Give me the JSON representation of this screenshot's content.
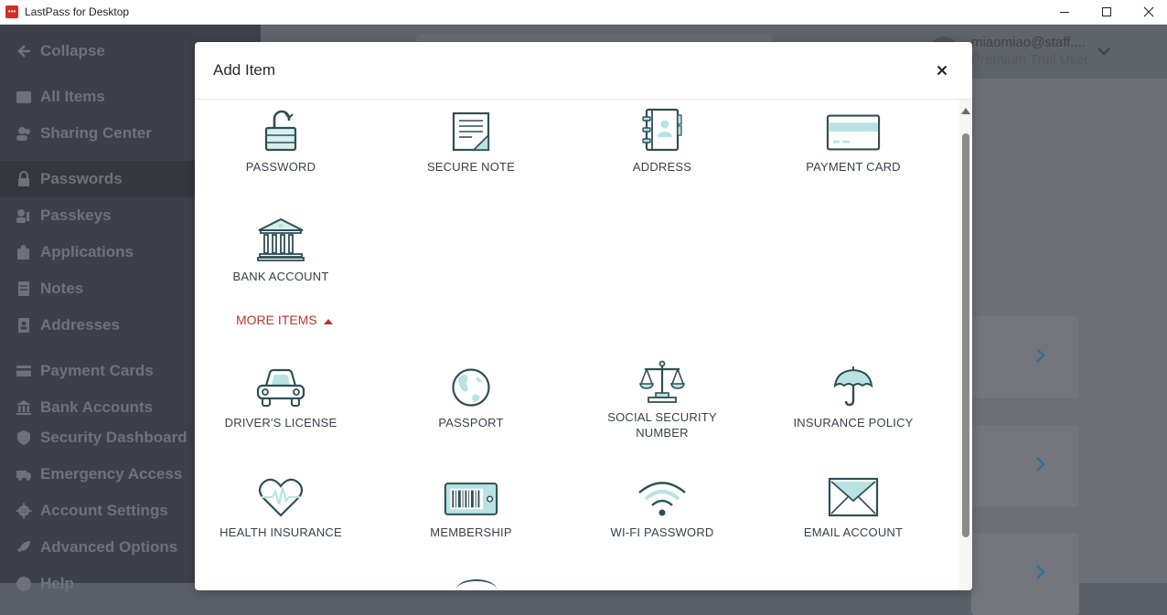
{
  "window": {
    "title": "LastPass for Desktop",
    "app_icon_glyph": "•••",
    "controls": [
      "minimize-icon",
      "maximize-icon",
      "close-icon"
    ]
  },
  "sidebar": {
    "collapse_label": "Collapse",
    "items": [
      {
        "label": "All Items",
        "icon": "home-icon"
      },
      {
        "label": "Sharing Center",
        "icon": "users-icon"
      },
      {
        "label": "Passwords",
        "icon": "lock-icon",
        "active": true
      },
      {
        "label": "Passkeys",
        "icon": "passkey-icon"
      },
      {
        "label": "Applications",
        "icon": "puzzle-icon"
      },
      {
        "label": "Notes",
        "icon": "note-icon"
      },
      {
        "label": "Addresses",
        "icon": "address-book-icon"
      },
      {
        "label": "Payment Cards",
        "icon": "card-icon"
      },
      {
        "label": "Bank Accounts",
        "icon": "bank-icon"
      },
      {
        "label": "Security Dashboard",
        "icon": "shield-icon"
      },
      {
        "label": "Emergency Access",
        "icon": "ambulance-icon"
      },
      {
        "label": "Account Settings",
        "icon": "gear-icon"
      },
      {
        "label": "Advanced Options",
        "icon": "rocket-icon"
      },
      {
        "label": "Help",
        "icon": "help-icon"
      }
    ]
  },
  "user": {
    "email": "miaomiao@staff....",
    "role": "Premium Trial User"
  },
  "modal": {
    "title": "Add Item",
    "more_items_label": "MORE ITEMS",
    "primary_items": [
      {
        "label": "PASSWORD",
        "icon": "padlock-icon"
      },
      {
        "label": "SECURE NOTE",
        "icon": "secure-note-icon"
      },
      {
        "label": "ADDRESS",
        "icon": "address-book-icon"
      },
      {
        "label": "PAYMENT CARD",
        "icon": "payment-card-icon"
      },
      {
        "label": "BANK ACCOUNT",
        "icon": "bank-icon"
      }
    ],
    "more_items": [
      {
        "label": "DRIVER'S LICENSE",
        "icon": "car-icon"
      },
      {
        "label": "PASSPORT",
        "icon": "globe-icon"
      },
      {
        "label": "SOCIAL SECURITY NUMBER",
        "icon": "scales-icon"
      },
      {
        "label": "INSURANCE POLICY",
        "icon": "umbrella-icon"
      },
      {
        "label": "HEALTH INSURANCE",
        "icon": "heart-pulse-icon"
      },
      {
        "label": "MEMBERSHIP",
        "icon": "barcode-card-icon"
      },
      {
        "label": "WI-FI PASSWORD",
        "icon": "wifi-icon"
      },
      {
        "label": "EMAIL ACCOUNT",
        "icon": "envelope-icon"
      }
    ]
  },
  "colors": {
    "icon_stroke": "#2f4f55",
    "icon_fill": "#b9e2e3",
    "accent_red": "#c0342d"
  }
}
